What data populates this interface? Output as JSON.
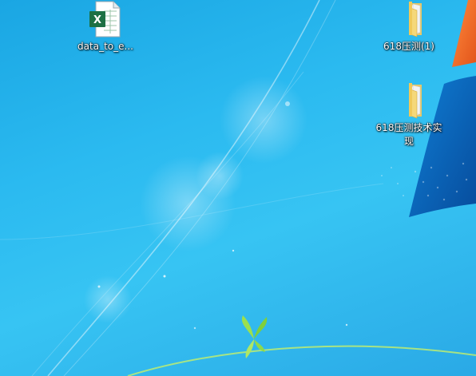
{
  "desktop": {
    "icons": [
      {
        "label": "data_to_e...",
        "icon": "excel-file-icon"
      },
      {
        "label": "618压测(1)",
        "icon": "folder-icon"
      },
      {
        "label": "618压测技术实现",
        "icon": "folder-icon"
      }
    ]
  },
  "colors": {
    "background": "#2bbaf0",
    "excel_green": "#1d7044",
    "folder_yellow": "#f5d87a",
    "logo_orange": "#f36c21",
    "logo_blue": "#0a5fb0",
    "leaf_green": "#8fd94a"
  }
}
